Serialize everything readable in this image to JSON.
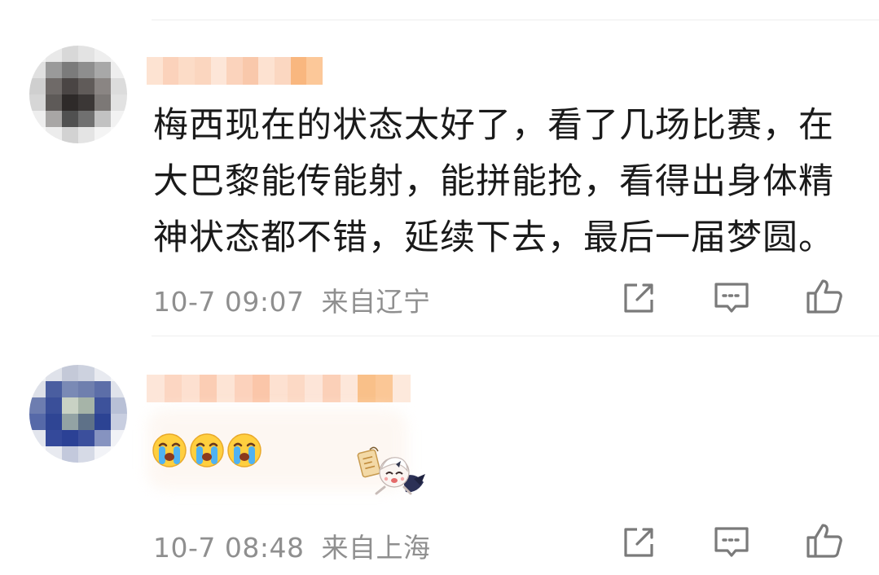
{
  "comments": [
    {
      "text_lines": [
        "梅西现在的状态太好了，看了几场比赛，在",
        "大巴黎能传能射，能拼能抢，看得出身体精",
        "神状态都不错，延续下去，最后一届梦圆。"
      ],
      "time": "10-7 09:07",
      "location": "来自辽宁",
      "avatar_icon": "blurred-avatar",
      "actions": [
        "share-icon",
        "comment-icon",
        "like-icon"
      ]
    },
    {
      "emojis": [
        "crying-face-icon",
        "crying-face-icon",
        "crying-face-icon"
      ],
      "sticker": "anime-sticker",
      "time": "10-7 08:48",
      "location": "来自上海",
      "avatar_icon": "blurred-avatar",
      "actions": [
        "share-icon",
        "comment-icon",
        "like-icon"
      ]
    }
  ],
  "colors": {
    "text": "#1a1a1a",
    "meta": "#8f8f8f",
    "icon": "#7a7a7a",
    "divider": "#eeeeee",
    "name_blur": "#f8b48a"
  }
}
